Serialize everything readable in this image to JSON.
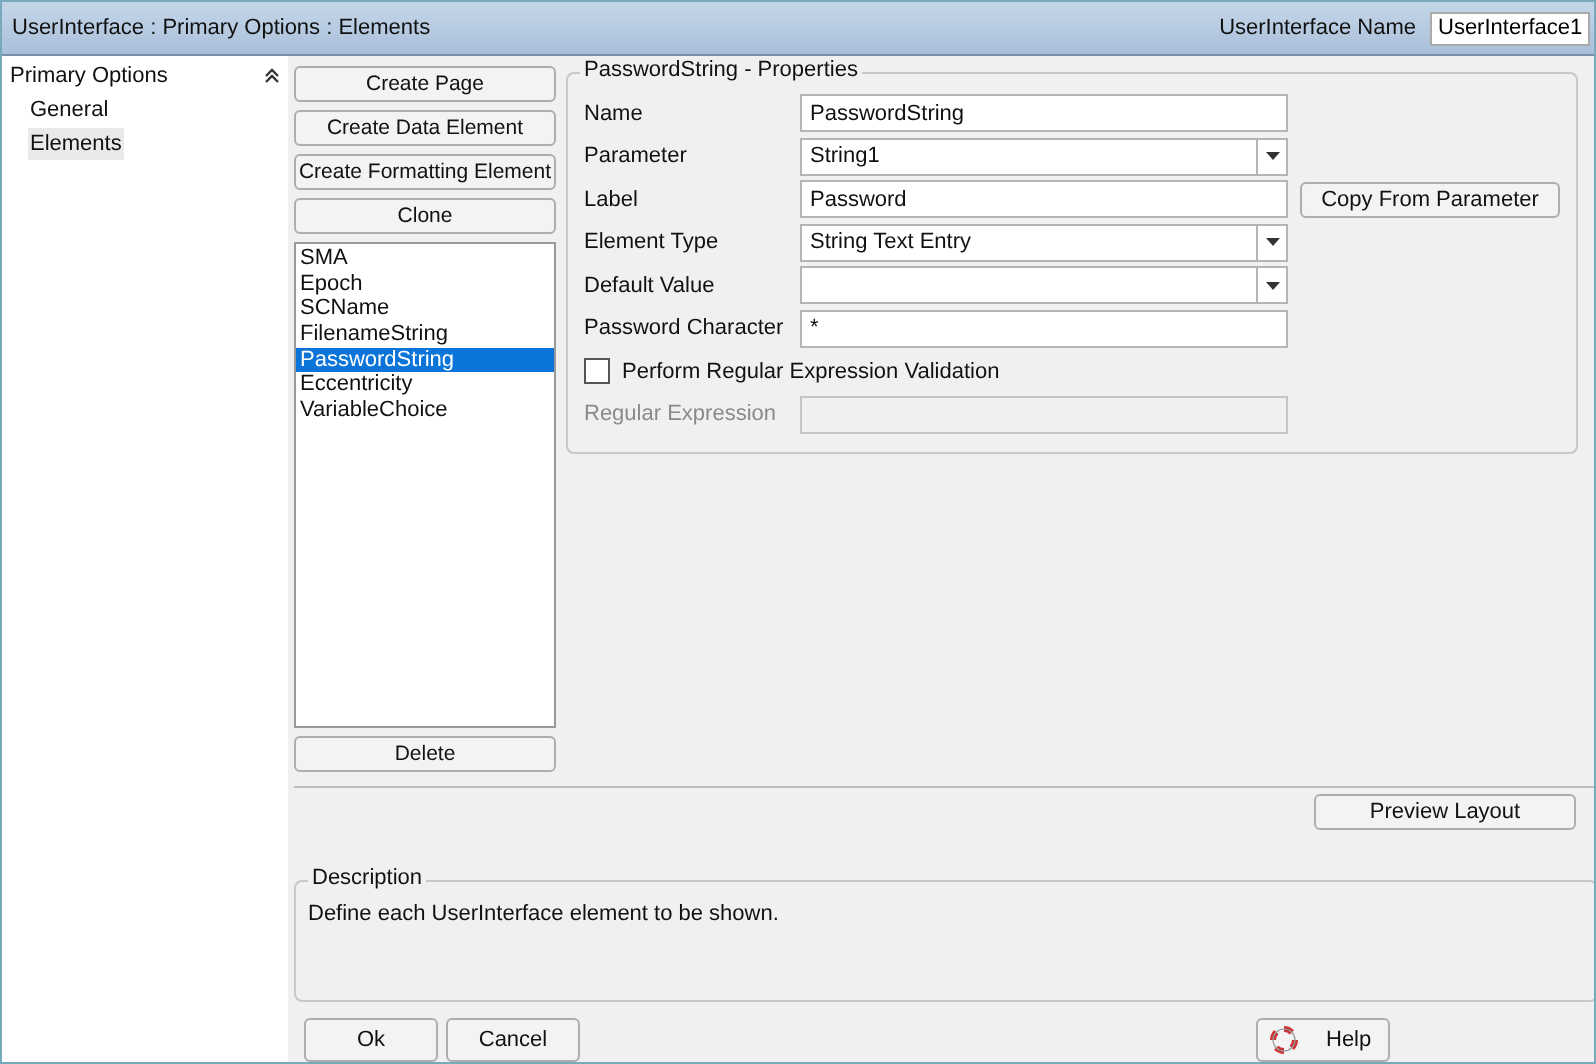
{
  "window": {
    "title": "UserInterface : Primary Options : Elements",
    "name_label": "UserInterface Name",
    "name_value": "UserInterface1"
  },
  "sidebar": {
    "title": "Primary Options",
    "expanded": true,
    "items": [
      {
        "label": "General",
        "selected": false
      },
      {
        "label": "Elements",
        "selected": true
      }
    ]
  },
  "actions": [
    "Create Page",
    "Create Data Element",
    "Create Formatting Element",
    "Clone"
  ],
  "elements": [
    {
      "label": "SMA",
      "selected": false
    },
    {
      "label": "Epoch",
      "selected": false
    },
    {
      "label": "SCName",
      "selected": false
    },
    {
      "label": "FilenameString",
      "selected": false
    },
    {
      "label": "PasswordString",
      "selected": true
    },
    {
      "label": "Eccentricity",
      "selected": false
    },
    {
      "label": "VariableChoice",
      "selected": false
    }
  ],
  "delete_button": "Delete",
  "properties": {
    "title": "PasswordString - Properties",
    "fields": [
      {
        "kind": "text",
        "label": "Name",
        "value": "PasswordString",
        "disabled": false
      },
      {
        "kind": "dropdown",
        "label": "Parameter",
        "value": "String1",
        "disabled": false
      },
      {
        "kind": "text",
        "label": "Label",
        "value": "Password",
        "disabled": false,
        "button": "Copy From Parameter"
      },
      {
        "kind": "dropdown",
        "label": "Element Type",
        "value": "String Text Entry",
        "disabled": false
      },
      {
        "kind": "dropdown",
        "label": "Default Value",
        "disabled": false
      },
      {
        "kind": "text",
        "label": "Password Character",
        "value": "*",
        "disabled": false
      },
      {
        "kind": "checkbox",
        "label": "Perform Regular Expression Validation",
        "checked": false
      },
      {
        "kind": "text",
        "label": "Regular Expression",
        "disabled": true
      }
    ]
  },
  "preview_button": "Preview Layout",
  "description": {
    "title": "Description",
    "text": "Define each UserInterface element to be shown."
  },
  "buttons": [
    {
      "label": "Ok",
      "kind": "plain"
    },
    {
      "label": "Cancel",
      "kind": "plain"
    },
    {
      "label": "Help",
      "kind": "help"
    }
  ]
}
